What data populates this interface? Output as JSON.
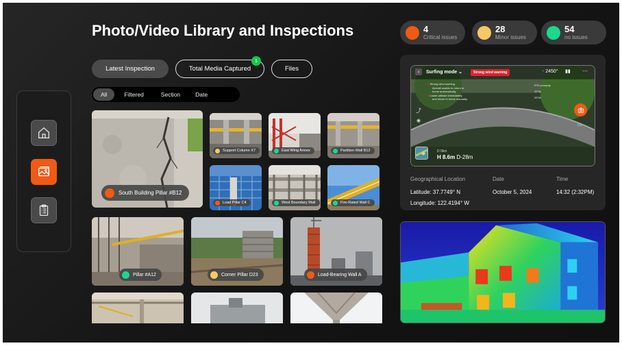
{
  "title": "Photo/Video Library and Inspections",
  "stats": [
    {
      "count": "4",
      "label": "Critical issues",
      "color": "#f05a14"
    },
    {
      "count": "28",
      "label": "Minor issues",
      "color": "#f7c965"
    },
    {
      "count": "54",
      "label": "no issues",
      "color": "#19d98c"
    }
  ],
  "pills": {
    "latest": "Latest Inspection",
    "total_media": "Total Media Captured",
    "total_media_badge": "1",
    "files": "Files"
  },
  "filters": [
    "All",
    "Filtered",
    "Section",
    "Date"
  ],
  "sidebar": {
    "items": [
      {
        "icon": "home-icon"
      },
      {
        "icon": "gallery-icon"
      },
      {
        "icon": "clipboard-icon"
      }
    ]
  },
  "gallery": [
    {
      "label": "South Building Pillar #B12",
      "status": "#f05a14"
    },
    {
      "label": "Support Column X7",
      "status": "#f7c965"
    },
    {
      "label": "East Wing Annex",
      "status": "#19d98c"
    },
    {
      "label": "Partition Wall B12",
      "status": "#19d98c"
    },
    {
      "label": "Load Pillar C4",
      "status": "#f05a14"
    },
    {
      "label": "West Boundary Wall",
      "status": "#19d98c"
    },
    {
      "label": "Fire-Rated Wall C",
      "status": "#19d98c"
    },
    {
      "label": "Pillar #A12",
      "status": "#19d98c"
    },
    {
      "label": "Corner Pillar D23",
      "status": "#f7c965"
    },
    {
      "label": "Load-Bearing Wall A",
      "status": "#f05a14"
    }
  ],
  "drone": {
    "mode": "Surfing mode",
    "warning": "Strong wind warning",
    "warning_text": [
      "Strong wind warning.",
      "Aircraft unable to return to",
      "home automatically.",
      "Lower altitude immediately",
      "and return to home manually."
    ],
    "speed": "2450°",
    "right_info": [
      "RTK-prompty",
      "22°W",
      "25°W"
    ],
    "distance": "D 0km",
    "height": "H 8.6m",
    "d_value": "D-28m"
  },
  "details": {
    "location_heading": "Geographical Location",
    "latitude": "Latitude: 37.7749° N",
    "longitude": "Longitude: 122.4194° W",
    "date_heading": "Date",
    "date": "October 5, 2024",
    "time_heading": "Time",
    "time": "14:32 (2:32PM)"
  }
}
